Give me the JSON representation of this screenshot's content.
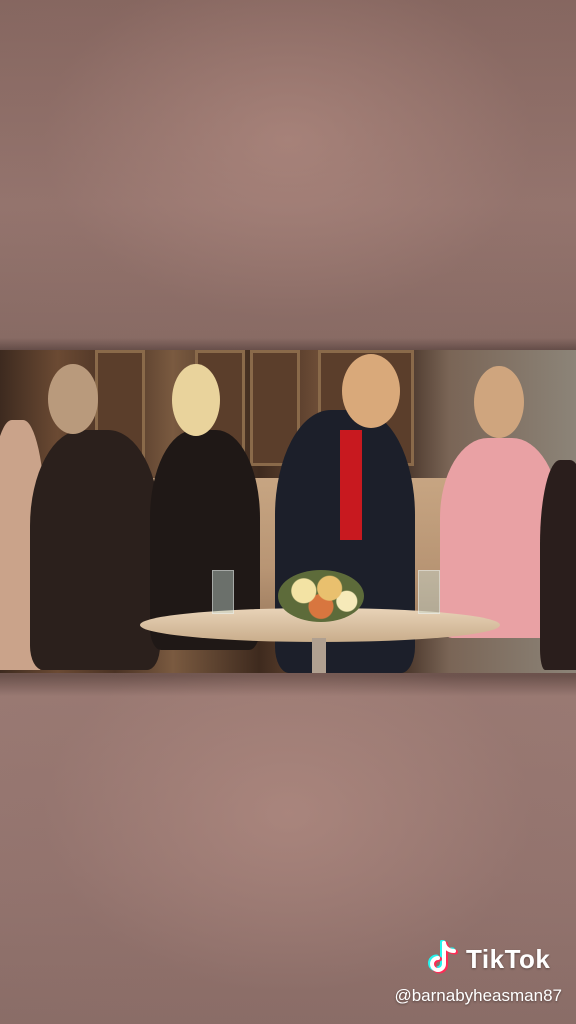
{
  "watermark": {
    "brand": "TikTok",
    "handle": "@barnabyheasman87",
    "icon": "tiktok-note-icon"
  },
  "colors": {
    "tiktok_cyan": "#25f4ee",
    "tiktok_red": "#fe2c55",
    "text": "#ffffff"
  }
}
